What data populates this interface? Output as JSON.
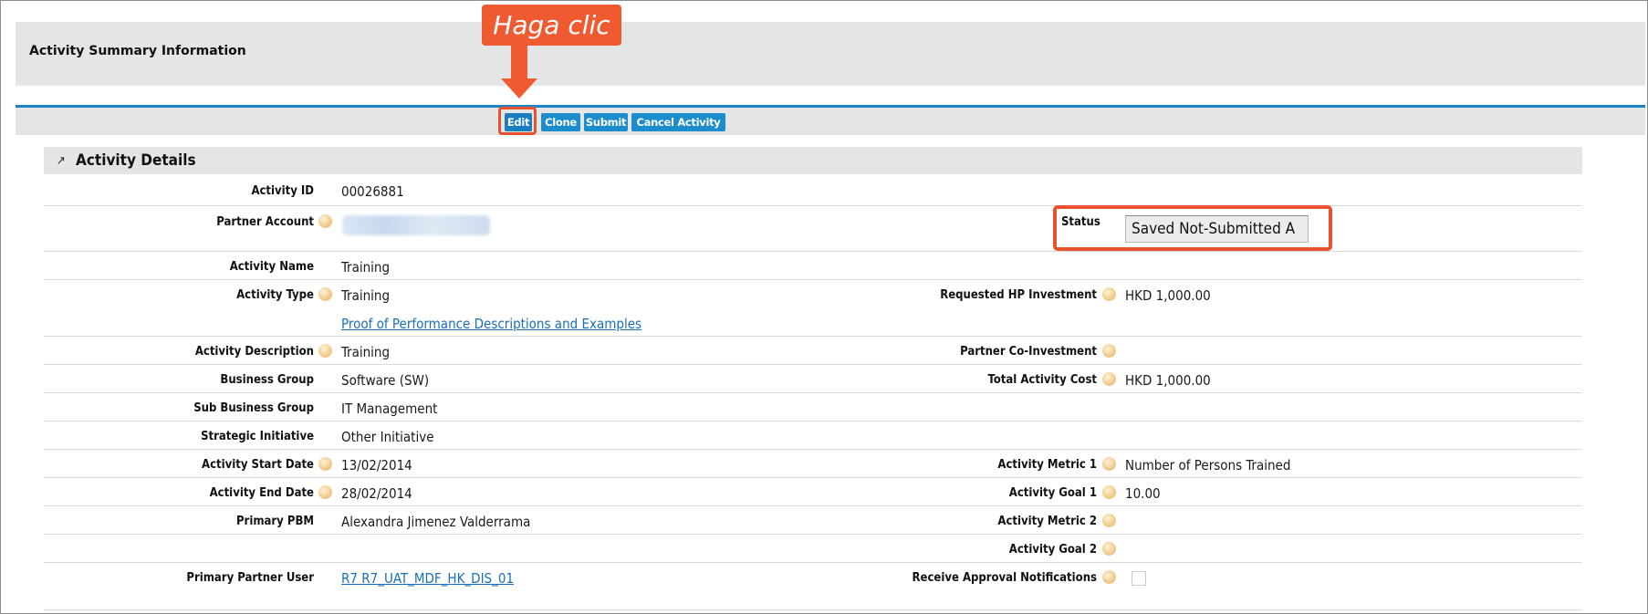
{
  "callout": {
    "text": "Haga clic"
  },
  "summary": {
    "title": "Activity Summary Information"
  },
  "toolbar": {
    "edit": "Edit",
    "clone": "Clone",
    "submit": "Submit",
    "cancel_activity": "Cancel Activity"
  },
  "section": {
    "title": "Activity Details",
    "collapse_icon": "collapse-arrow"
  },
  "fields": {
    "activity_id": {
      "label": "Activity ID",
      "value": "00026881"
    },
    "partner_account": {
      "label": "Partner Account"
    },
    "status": {
      "label": "Status",
      "value": "Saved Not-Submitted A"
    },
    "activity_name": {
      "label": "Activity Name",
      "value": "Training"
    },
    "activity_type": {
      "label": "Activity Type",
      "value": "Training"
    },
    "requested_hp_investment": {
      "label": "Requested HP Investment",
      "value": "HKD 1,000.00"
    },
    "proof_link": "Proof of Performance Descriptions and Examples",
    "activity_description": {
      "label": "Activity Description",
      "value": "Training"
    },
    "partner_co_investment": {
      "label": "Partner Co-Investment"
    },
    "business_group": {
      "label": "Business Group",
      "value": "Software (SW)"
    },
    "total_activity_cost": {
      "label": "Total Activity Cost",
      "value": "HKD 1,000.00"
    },
    "sub_business_group": {
      "label": "Sub Business Group",
      "value": "IT Management"
    },
    "strategic_initiative": {
      "label": "Strategic Initiative",
      "value": "Other Initiative"
    },
    "activity_start_date": {
      "label": "Activity Start Date",
      "value": "13/02/2014"
    },
    "activity_metric_1": {
      "label": "Activity Metric 1",
      "value": "Number of Persons Trained"
    },
    "activity_end_date": {
      "label": "Activity End Date",
      "value": "28/02/2014"
    },
    "activity_goal_1": {
      "label": "Activity Goal 1",
      "value": "10.00"
    },
    "primary_pbm": {
      "label": "Primary PBM",
      "value": "Alexandra Jimenez Valderrama"
    },
    "activity_metric_2": {
      "label": "Activity Metric 2"
    },
    "activity_goal_2": {
      "label": "Activity Goal 2"
    },
    "primary_partner_user": {
      "label": "Primary Partner User",
      "value": "R7 R7_UAT_MDF_HK_DIS_01"
    },
    "receive_approval_notifications": {
      "label": "Receive Approval Notifications",
      "checked": false
    }
  },
  "colors": {
    "accent": "#1b8ccc",
    "callout": "#ef5a30",
    "panel": "#e3e5e7",
    "link": "#1b6fb8"
  }
}
